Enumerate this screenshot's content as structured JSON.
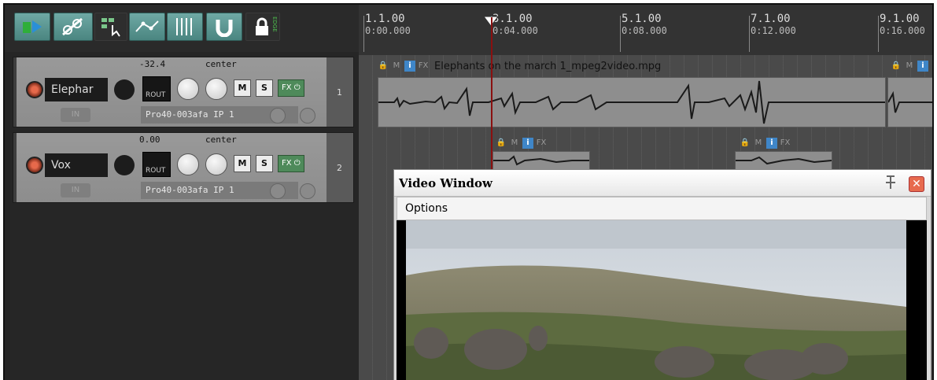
{
  "toolbar": {
    "buttons": [
      {
        "name": "grid-snap-icon",
        "style": "green"
      },
      {
        "name": "ripple-edit-icon",
        "style": "green"
      },
      {
        "name": "item-grouping-icon",
        "style": "dark"
      },
      {
        "name": "envelope-points-icon",
        "style": "green"
      },
      {
        "name": "grid-lines-icon",
        "style": "green"
      },
      {
        "name": "snap-magnet-icon",
        "style": "green"
      },
      {
        "name": "lock-icon",
        "style": "dark"
      }
    ],
    "lock_badge": "EDGE"
  },
  "tracks": [
    {
      "name": "Elephar",
      "volume": "-32.4",
      "pan": "center",
      "rout": "ROUT",
      "mute": "M",
      "solo": "S",
      "fx": "FX",
      "in": "IN",
      "fx_chain": "Pro40-003afa IP 1",
      "number": "1"
    },
    {
      "name": "Vox",
      "volume": "0.00",
      "pan": "center",
      "rout": "ROUT",
      "mute": "M",
      "solo": "S",
      "fx": "FX",
      "in": "IN",
      "fx_chain": "Pro40-003afa IP 1",
      "number": "2"
    }
  ],
  "ruler": [
    {
      "bar": "1.1.00",
      "time": "0:00.000"
    },
    {
      "bar": "3.1.00",
      "time": "0:04.000"
    },
    {
      "bar": "5.1.00",
      "time": "0:08.000"
    },
    {
      "bar": "7.1.00",
      "time": "0:12.000"
    },
    {
      "bar": "9.1.00",
      "time": "0:16.000"
    }
  ],
  "items": {
    "main": {
      "lock": "🔒",
      "mute": "M",
      "info": "i",
      "fx": "FX",
      "title": "Elephants on the march 1_mpeg2video.mpg"
    },
    "vox1": {
      "lock": "🔒",
      "mute": "M",
      "info": "i",
      "fx": "FX"
    },
    "vox2": {
      "lock": "🔒",
      "mute": "M",
      "info": "i",
      "fx": "FX"
    },
    "right": {
      "lock": "🔒",
      "mute": "M",
      "info": "i"
    }
  },
  "video_window": {
    "title": "Video Window",
    "menu": "Options"
  },
  "colors": {
    "accent_green": "#4a8580",
    "info_blue": "#3f86c8",
    "record_red": "#e6694b",
    "cursor_red": "#8a1010"
  }
}
